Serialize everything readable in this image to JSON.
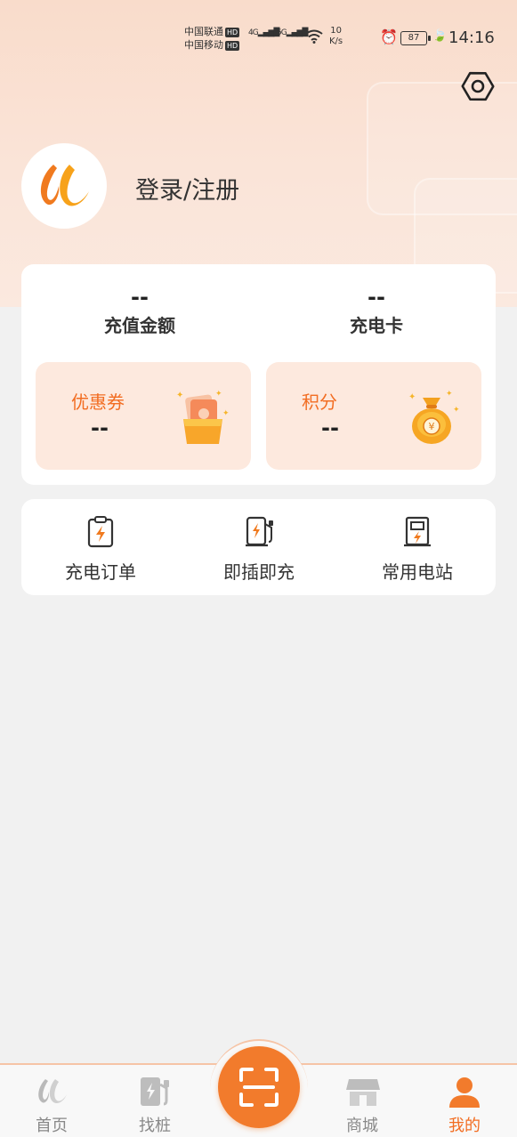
{
  "status_bar": {
    "carrier1": "中国联通",
    "carrier2": "中国移动",
    "hd": "HD",
    "sig1": "4G",
    "sig2": "5G",
    "speed_value": "10",
    "speed_unit": "K/s",
    "battery": "87",
    "time": "14:16"
  },
  "profile": {
    "login_label": "登录/注册"
  },
  "account": {
    "recharge_value": "--",
    "recharge_label": "充值金额",
    "card_value": "--",
    "card_label": "充电卡",
    "coupon_label": "优惠券",
    "coupon_value": "--",
    "points_label": "积分",
    "points_value": "--"
  },
  "quick_actions": [
    {
      "label": "充电订单",
      "icon": "charging-order-icon"
    },
    {
      "label": "即插即充",
      "icon": "plug-and-charge-icon"
    },
    {
      "label": "常用电站",
      "icon": "favorite-station-icon"
    }
  ],
  "bottom_nav": {
    "items": [
      {
        "label": "首页",
        "icon": "home-logo-icon"
      },
      {
        "label": "找桩",
        "icon": "charging-pile-icon"
      },
      {
        "label": "商城",
        "icon": "store-icon"
      },
      {
        "label": "我的",
        "icon": "person-icon"
      }
    ],
    "active_index": 3
  },
  "colors": {
    "accent": "#f26d22",
    "header_bg": "#f9dccb",
    "promo_bg": "#fde9de"
  }
}
